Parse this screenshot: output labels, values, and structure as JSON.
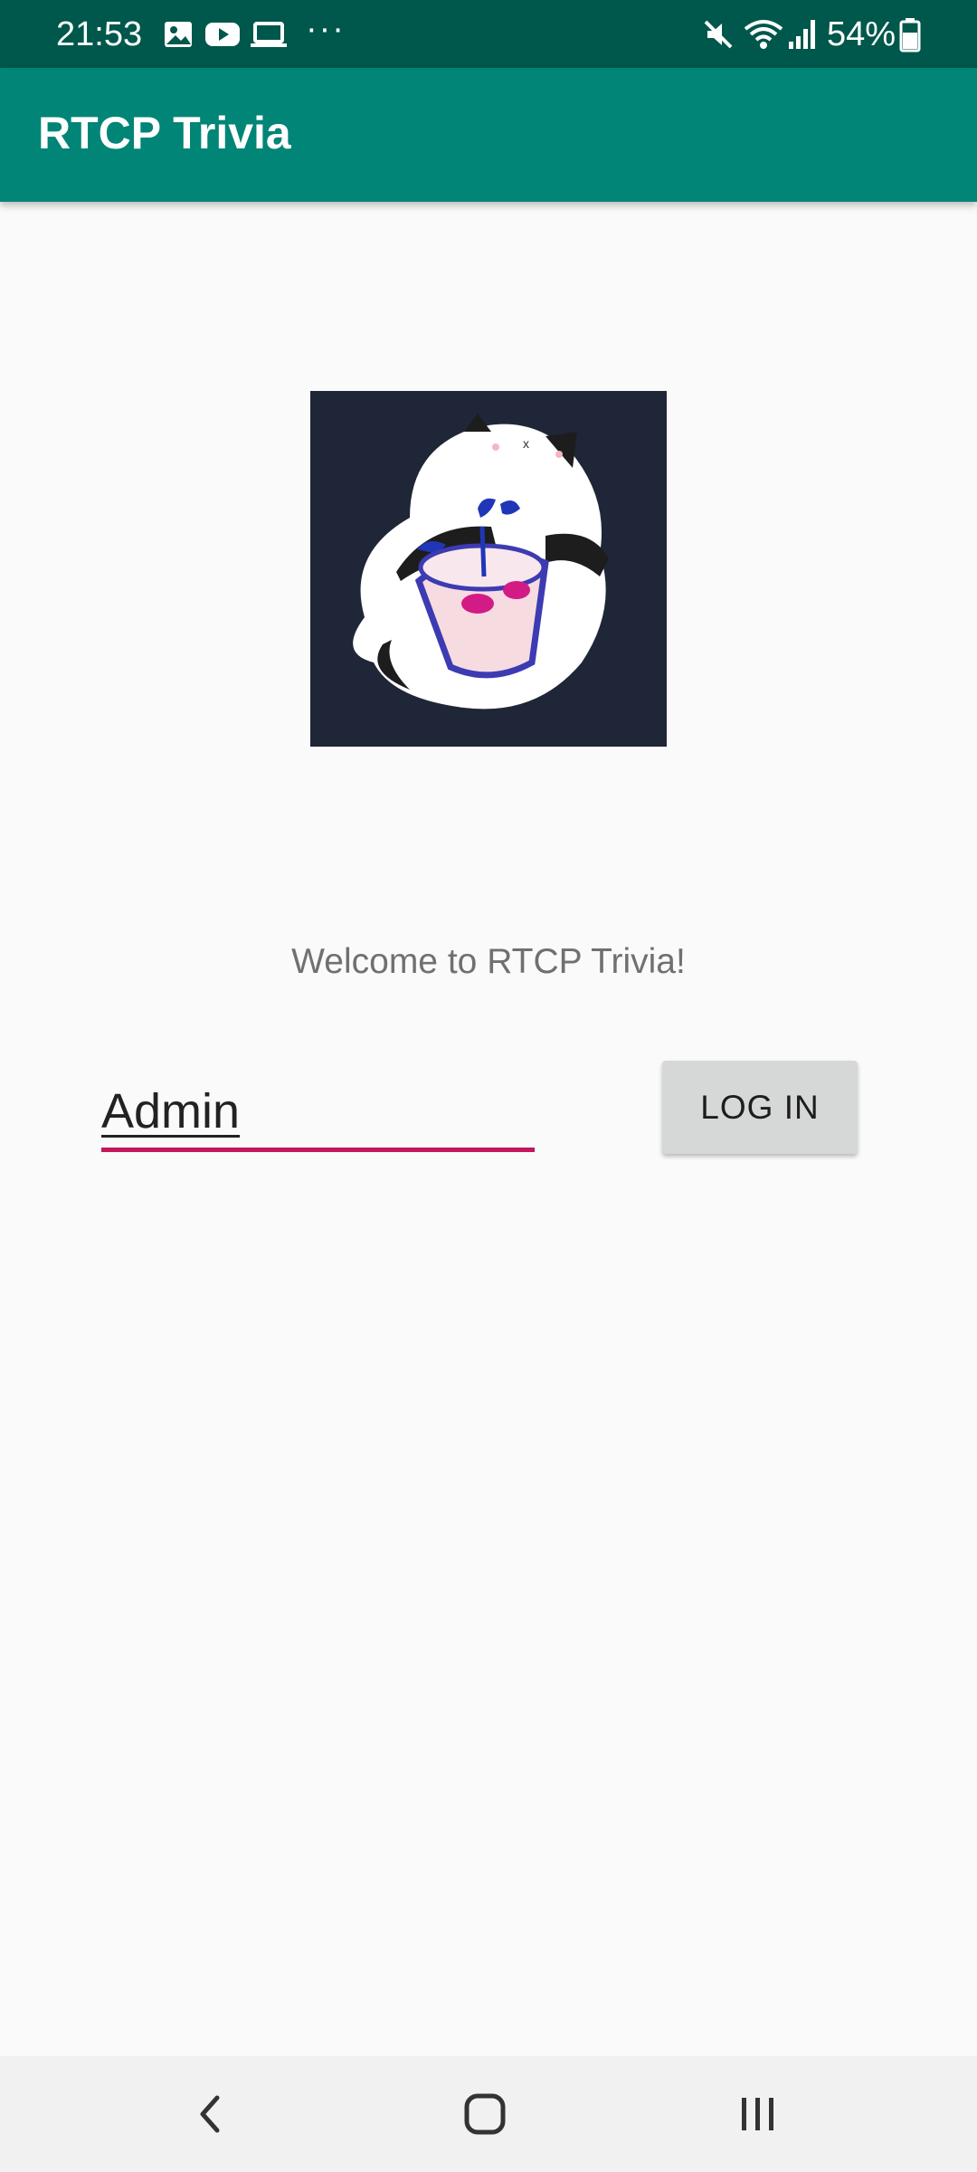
{
  "status_bar": {
    "time": "21:53",
    "battery": "54%",
    "left_icons": [
      "image-icon",
      "youtube-icon",
      "laptop-icon",
      "more-dots-icon"
    ],
    "right_icons": [
      "mute-icon",
      "wifi-icon",
      "signal-icon",
      "battery-icon"
    ],
    "more_dots": "···"
  },
  "app_bar": {
    "title": "RTCP Trivia"
  },
  "main": {
    "logo_image": "cat-with-flowerpot-illustration",
    "welcome": "Welcome to RTCP Trivia!",
    "name_input": {
      "value": "Admin"
    },
    "login_button": "LOG IN"
  },
  "nav_bar": {
    "icons": [
      "back-icon",
      "home-icon",
      "recents-icon"
    ]
  },
  "colors": {
    "status_bar": "#00574b",
    "app_bar": "#008577",
    "background": "#fafafa",
    "accent": "#c2185b",
    "button": "#d6d7d7",
    "logo_background": "#1f2637"
  }
}
